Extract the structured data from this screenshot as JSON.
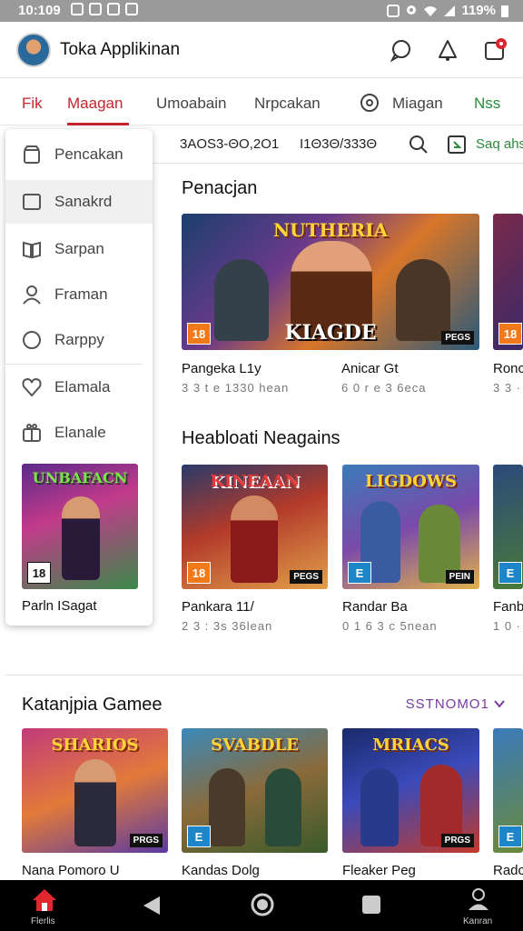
{
  "status": {
    "time": "10:109",
    "battery": "119%"
  },
  "app": {
    "title": "Toka Applikinan"
  },
  "tabs": [
    "Fik",
    "Maagan",
    "Umoabain",
    "Nrpcakan",
    "Miagan",
    "Nss"
  ],
  "search": {
    "left": "3AOS3-ΘO,2O1",
    "right": "I1Θ3Θ/333Θ",
    "link": "Saq ahs"
  },
  "drawer": {
    "items": [
      {
        "label": "Pencakan",
        "icon": "bag-icon"
      },
      {
        "label": "Sanakrd",
        "icon": "square-icon"
      },
      {
        "label": "Sarpan",
        "icon": "book-icon"
      },
      {
        "label": "Framan",
        "icon": "person-icon"
      },
      {
        "label": "Rarppy",
        "icon": "circle-icon"
      },
      {
        "label": "Elamala",
        "icon": "heart-icon"
      },
      {
        "label": "Elanale",
        "icon": "gift-icon"
      }
    ],
    "promo": {
      "title": "Parln ISagat",
      "art": "UNBAFACN",
      "badge": "18"
    }
  },
  "section1": {
    "title": "Penacjan",
    "cards": [
      {
        "title": "Pangeka L1y",
        "sub": "3 3 t e 1330 hean",
        "badge": "18",
        "badge2": "PEGS",
        "art": "KIAGDE",
        "top": "NUTHERIA"
      },
      {
        "title": "Anicar Gt",
        "sub": "6 0 r e 3 6eca",
        "badge": "",
        "badge2": "",
        "art": "",
        "top": ""
      },
      {
        "title": "Ronc",
        "sub": "3 3 ·",
        "badge": "18",
        "badge2": "",
        "art": "",
        "top": ""
      }
    ]
  },
  "section2": {
    "title": "Heabloati Neagains",
    "cards": [
      {
        "title": "Pankara 11/",
        "sub": "2 3 : 3s 36lean",
        "badge": "18",
        "badge2": "PEGS",
        "art": "KINEAAN"
      },
      {
        "title": "Randar Ba",
        "sub": "0 1 6 3 c 5nean",
        "badge": "E",
        "badge2": "PEIN",
        "art": "LIGDOWS"
      },
      {
        "title": "Fanb",
        "sub": "1 0 ·",
        "badge": "E",
        "badge2": "",
        "art": ""
      }
    ]
  },
  "section3": {
    "title": "Katanjpia Gamee",
    "see_all": "SSTNOMO1",
    "cards": [
      {
        "title": "Nana Pomoro U",
        "badge2": "PRGS",
        "art": "SHARIOS"
      },
      {
        "title": "Kandas Dolg",
        "badge": "E",
        "art": "SVABDLE"
      },
      {
        "title": "Fleaker Peg",
        "badge2": "PRGS",
        "art": "MRIACS"
      },
      {
        "title": "Radc",
        "badge": "E",
        "art": ""
      }
    ]
  },
  "nav": {
    "home": "Flerlis",
    "account": "Kanran"
  },
  "colors": {
    "accent": "#c4262e",
    "link": "#2a8a3a",
    "seeall": "#7a3aa0"
  }
}
